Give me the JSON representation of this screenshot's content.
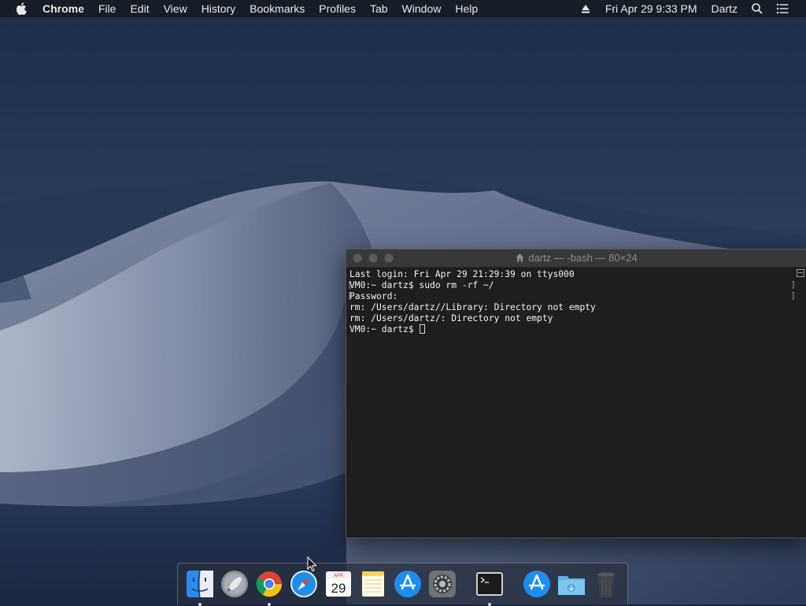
{
  "menubar": {
    "app_name": "Chrome",
    "menus": [
      "File",
      "Edit",
      "View",
      "History",
      "Bookmarks",
      "Profiles",
      "Tab",
      "Window",
      "Help"
    ],
    "date_time": "Fri Apr 29  9:33 PM",
    "user": "Dartz",
    "icons": [
      "apple-icon",
      "eject-icon",
      "spotlight-search-icon",
      "notification-center-icon"
    ]
  },
  "terminal": {
    "title": "dartz — -bash — 80×24",
    "lines": [
      "Last login: Fri Apr 29 21:29:39 on ttys000",
      "VM0:~ dartz$ sudo rm -rf ~/",
      "Password:",
      "rm: /Users/dartz//Library: Directory not empty",
      "rm: /Users/dartz/: Directory not empty",
      "VM0:~ dartz$ "
    ]
  },
  "dock": {
    "apps": [
      "Finder",
      "Launchpad",
      "Google Chrome",
      "Safari",
      "Calendar",
      "Notes",
      "App Store",
      "System Preferences",
      "Terminal",
      "Applications",
      "Downloads",
      "Trash"
    ],
    "calendar": {
      "month": "APR",
      "day": "29"
    },
    "running": [
      "Finder",
      "Google Chrome",
      "Terminal"
    ]
  },
  "colors": {
    "menubar_bg": "#161d27",
    "terminal_bg": "#1e1e1e",
    "terminal_text": "#f2f2f2"
  }
}
